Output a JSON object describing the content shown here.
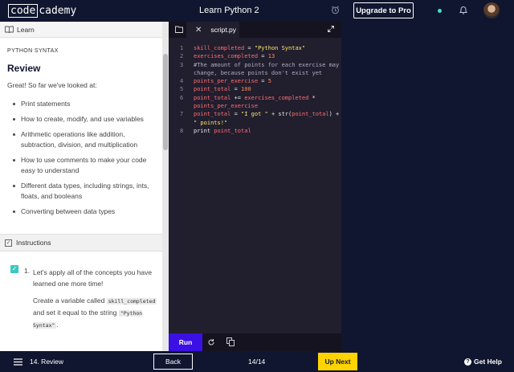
{
  "header": {
    "logo_code": "code",
    "logo_cademy": "cademy",
    "course_title": "Learn Python 2",
    "upgrade_label": "Upgrade to Pro"
  },
  "lesson": {
    "panel_label": "Learn",
    "subtitle": "PYTHON SYNTAX",
    "title": "Review",
    "intro": "Great! So far we've looked at:",
    "bullets": [
      "Print statements",
      "How to create, modify, and use variables",
      "Arithmetic operations like addition, subtraction, division, and multiplication",
      "How to use comments to make your code easy to understand",
      "Different data types, including strings, ints, floats, and booleans",
      "Converting between data types"
    ],
    "instructions_label": "Instructions",
    "task_number": "1.",
    "task_text": "Let's apply all of the concepts you have learned one more time!",
    "task_detail_1": "Create a variable called",
    "task_code_1": "skill_completed",
    "task_detail_2": "and set it equal to the string",
    "task_code_2": "\"Python Syntax\"",
    "task_detail_3": "."
  },
  "editor": {
    "tab_name": "script.py",
    "run_label": "Run",
    "lines": [
      {
        "n": "1",
        "tokens": [
          [
            "v",
            "skill_completed"
          ],
          [
            "o",
            " = "
          ],
          [
            "s",
            "\"Python Syntax\""
          ]
        ]
      },
      {
        "n": "2",
        "tokens": [
          [
            "v",
            "exercises_completed"
          ],
          [
            "o",
            " = "
          ],
          [
            "n",
            "13"
          ]
        ]
      },
      {
        "n": "3",
        "tokens": [
          [
            "c",
            "#The amount of points for each exercise may change, because points don't exist yet"
          ]
        ]
      },
      {
        "n": "4",
        "tokens": [
          [
            "v",
            "points_per_exercise"
          ],
          [
            "o",
            " = "
          ],
          [
            "n",
            "5"
          ]
        ]
      },
      {
        "n": "5",
        "tokens": [
          [
            "v",
            "point_total"
          ],
          [
            "o",
            " = "
          ],
          [
            "n",
            "100"
          ]
        ]
      },
      {
        "n": "6",
        "tokens": [
          [
            "v",
            "point_total"
          ],
          [
            "o",
            " += "
          ],
          [
            "v",
            "exercises_completed"
          ],
          [
            "o",
            " * "
          ],
          [
            "v",
            "points_per_exercise"
          ]
        ]
      },
      {
        "n": "7",
        "tokens": [
          [
            "v",
            "point_total"
          ],
          [
            "o",
            " = "
          ],
          [
            "s",
            "\"I got \""
          ],
          [
            "o",
            " + str("
          ],
          [
            "v",
            "point_total"
          ],
          [
            "o",
            ") + "
          ],
          [
            "s",
            "\" points!\""
          ]
        ]
      },
      {
        "n": "8",
        "tokens": [
          [
            "k",
            "print "
          ],
          [
            "v",
            "point_total"
          ]
        ]
      }
    ]
  },
  "footer": {
    "lesson_label": "14. Review",
    "back_label": "Back",
    "progress": "14/14",
    "next_label": "Up Next",
    "help_label": "Get Help"
  },
  "colors": {
    "background": "#10162f",
    "run_button": "#3a10e5",
    "next_button": "#ffd300",
    "status_dot": "#3ee0c8",
    "check": "#3bc8c0"
  },
  "icons": [
    "alarm-icon",
    "bell-icon",
    "book-icon",
    "files-icon",
    "expand-icon",
    "reset-icon",
    "copy-icon",
    "menu-icon",
    "help-icon"
  ]
}
